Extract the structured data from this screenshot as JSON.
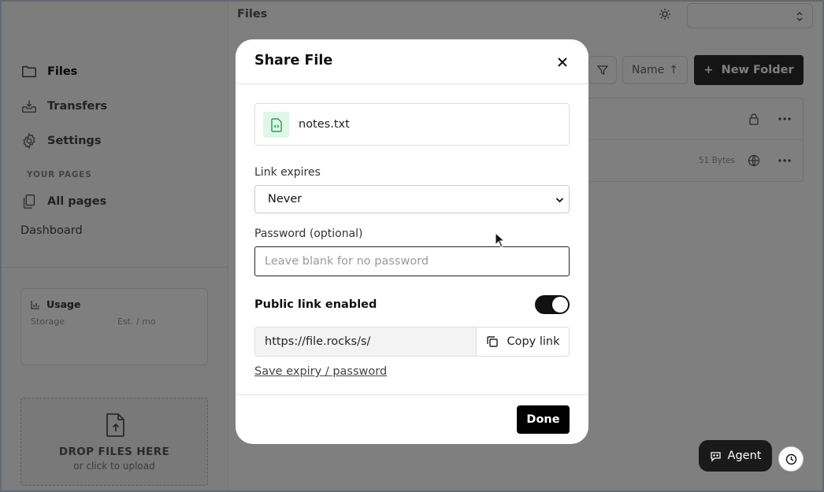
{
  "sidebar": {
    "nav": {
      "files": "Files",
      "transfers": "Transfers",
      "settings": "Settings",
      "section_label": "YOUR PAGES",
      "all_pages": "All pages",
      "dashboard": "Dashboard"
    },
    "usage": {
      "title": "Usage",
      "storage_label": "Storage",
      "est_label": "Est. / mo"
    },
    "drop_zone": {
      "title": "DROP FILES HERE",
      "subtitle": "or click to upload"
    }
  },
  "main": {
    "title": "Files",
    "sort_label": "Name",
    "sort_arrow": "↑",
    "new_folder_label": "New Folder",
    "rows": [
      {
        "size": "",
        "icon": "lock-icon"
      },
      {
        "size": "51 Bytes",
        "icon": "globe-icon"
      }
    ]
  },
  "modal": {
    "title": "Share File",
    "file_name": "notes.txt",
    "expires_label": "Link expires",
    "expires_value": "Never",
    "password_label": "Password (optional)",
    "password_placeholder": "Leave blank for no password",
    "public_label": "Public link enabled",
    "public_enabled": true,
    "link_value": "https://file.rocks/s/",
    "copy_label": "Copy link",
    "save_label": "Save expiry / password",
    "done_label": "Done"
  },
  "floating": {
    "agent_label": "Agent"
  },
  "colors": {
    "accent": "#000000",
    "file_badge_bg": "#dff6e8",
    "file_badge_icon": "#2e9b5a"
  }
}
